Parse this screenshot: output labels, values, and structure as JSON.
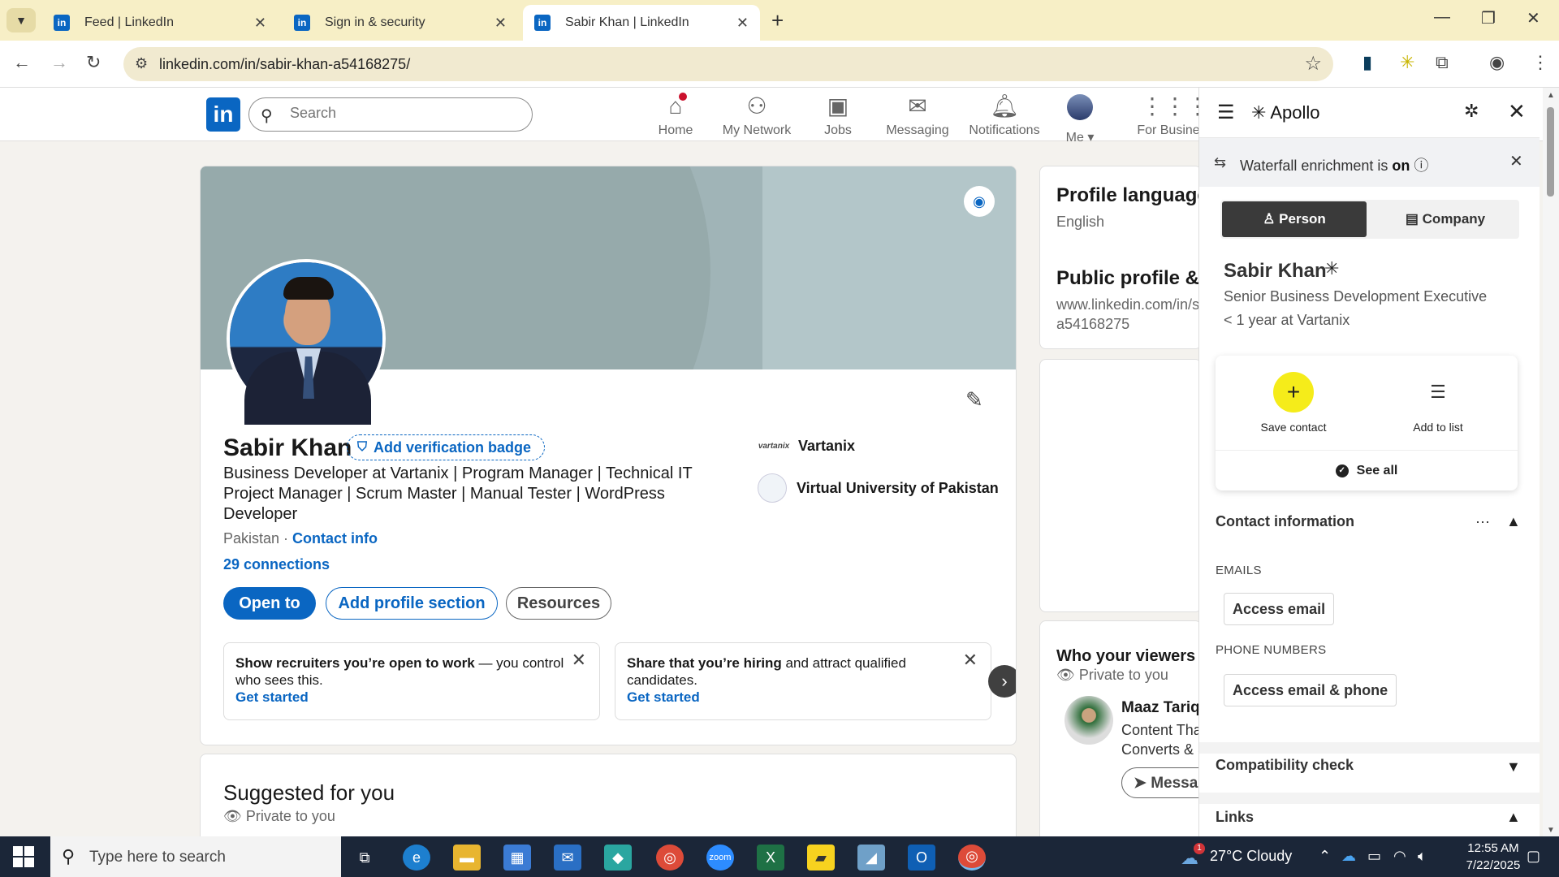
{
  "browser": {
    "tabs": [
      {
        "title": "Feed | LinkedIn",
        "active": false
      },
      {
        "title": "Sign in & security",
        "active": false
      },
      {
        "title": "Sabir Khan | LinkedIn",
        "active": true
      }
    ],
    "url": "linkedin.com/in/sabir-khan-a54168275/"
  },
  "linkedin": {
    "search_placeholder": "Search",
    "nav": [
      {
        "label": "Home",
        "icon": "home-icon"
      },
      {
        "label": "My Network",
        "icon": "people-icon"
      },
      {
        "label": "Jobs",
        "icon": "briefcase-icon"
      },
      {
        "label": "Messaging",
        "icon": "chat-icon"
      },
      {
        "label": "Notifications",
        "icon": "bell-icon"
      },
      {
        "label": "Me",
        "icon": "avatar"
      },
      {
        "label": "For Business",
        "icon": "grid-icon"
      }
    ]
  },
  "profile": {
    "name": "Sabir Khan",
    "verify_badge": "Add verification badge",
    "headline": "Business Developer at Vartanix | Program Manager | Technical IT Project Manager | Scrum Master | Manual Tester | WordPress Developer",
    "location": "Pakistan",
    "location_sep": " · ",
    "contact_info": "Contact info",
    "connections": "29 connections",
    "orgs": [
      {
        "name": "Vartanix",
        "logo_text": "vartanix"
      },
      {
        "name": "Virtual University of Pakistan",
        "logo_text": ""
      }
    ],
    "buttons": {
      "open_to": "Open to",
      "add_section": "Add profile section",
      "resources": "Resources"
    },
    "promos": [
      {
        "bold": "Show recruiters you’re open to work",
        "rest": " — you control who sees this.",
        "cta": "Get started"
      },
      {
        "bold": "Share that you’re hiring",
        "rest": " and attract qualified candidates.",
        "cta": "Get started"
      }
    ]
  },
  "suggested": {
    "title": "Suggested for you",
    "privacy": "Private to you"
  },
  "right_rail": {
    "profile_language": {
      "title": "Profile language",
      "value": "English"
    },
    "public_profile": {
      "title": "Public profile & U",
      "url_line1": "www.linkedin.com/in/s",
      "url_line2": "a54168275"
    },
    "viewers": {
      "title": "Who your viewers",
      "privacy": "Private to you",
      "person_name": "Maaz Tariq",
      "person_line1": "Content Tha",
      "person_line2": "Converts & S",
      "message_btn": "Messa"
    }
  },
  "apollo": {
    "brand": "Apollo",
    "banner_text": "Waterfall enrichment is ",
    "banner_state": "on",
    "tabs": {
      "person": "Person",
      "company": "Company"
    },
    "name": "Sabir Khan",
    "title": "Senior Business Development Executive",
    "tenure": "< 1 year at Vartanix",
    "actions": {
      "save": "Save contact",
      "list": "Add to list",
      "see_all": "See all"
    },
    "contact_section": "Contact information",
    "emails_caption": "EMAILS",
    "access_email": "Access email",
    "phones_caption": "PHONE NUMBERS",
    "access_email_phone": "Access email & phone",
    "compat_section": "Compatibility check",
    "links_section": "Links"
  },
  "taskbar": {
    "search_placeholder": "Type here to search",
    "weather": "27°C  Cloudy",
    "time": "12:55 AM",
    "date": "7/22/2025",
    "weather_badge": "1"
  },
  "colors": {
    "linkedin_blue": "#0a66c2",
    "apollo_yellow": "#f5ec1a",
    "tab_bar": "#f7efc6"
  }
}
